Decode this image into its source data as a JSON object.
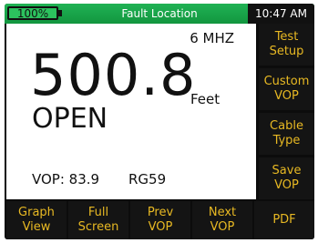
{
  "status_bar": {
    "battery": "100%",
    "title": "Fault Location",
    "time": "10:47 AM"
  },
  "display": {
    "frequency": "6 MHZ",
    "distance": "500.8",
    "unit": "Feet",
    "status": "OPEN",
    "vop": "VOP: 83.9",
    "cable": "RG59"
  },
  "side_keys": [
    "Test\nSetup",
    "Custom\nVOP",
    "Cable\nType",
    "Save\nVOP"
  ],
  "bottom_keys": [
    "Graph\nView",
    "Full\nScreen",
    "Prev\nVOP",
    "Next\nVOP",
    "PDF"
  ],
  "colors": {
    "status_bar": "#20b254",
    "softkey_text": "#e8b923",
    "softkey_bg": "#141414"
  }
}
